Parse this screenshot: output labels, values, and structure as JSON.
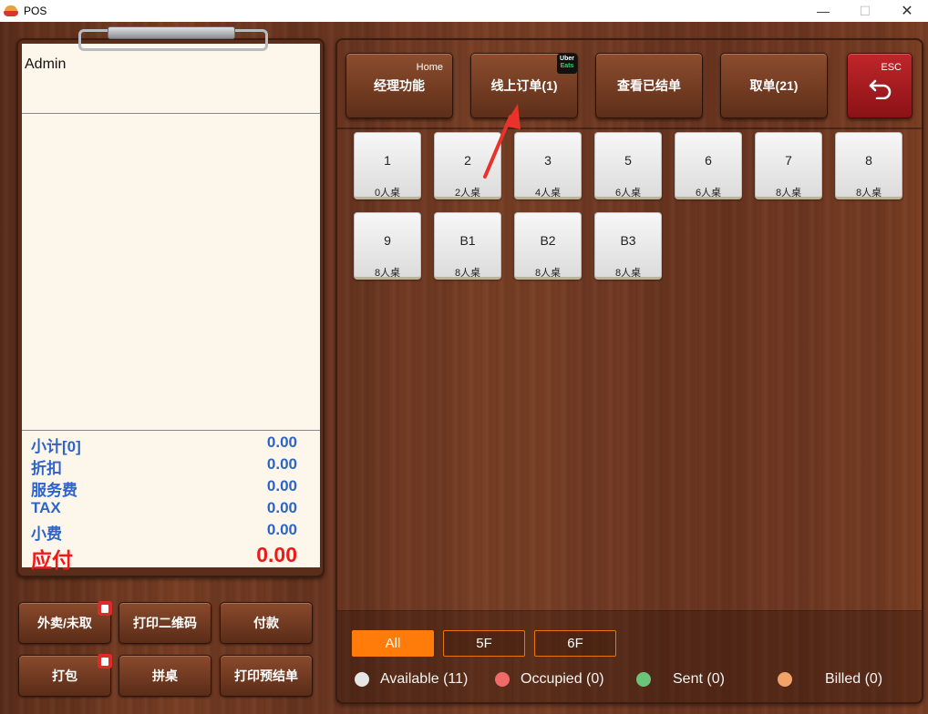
{
  "window": {
    "title": "POS",
    "minimize": "—",
    "maximize": "☐",
    "close": "✕"
  },
  "receipt": {
    "user": "Admin",
    "summary": [
      {
        "label": "小计[0]",
        "value": "0.00"
      },
      {
        "label": "折扣",
        "value": "0.00"
      },
      {
        "label": "服务费",
        "value": "0.00"
      },
      {
        "label": "TAX",
        "value": "0.00"
      },
      {
        "label": "小费",
        "value": "0.00"
      }
    ],
    "due": {
      "label": "应付",
      "value": "0.00"
    }
  },
  "left_buttons": {
    "takeout": "外卖/未取",
    "print_qr": "打印二维码",
    "pay": "付款",
    "pack": "打包",
    "merge": "拼桌",
    "print_prebill": "打印预结单"
  },
  "top_buttons": {
    "manager": {
      "label": "经理功能",
      "corner": "Home"
    },
    "online_orders": {
      "label": "线上订单(1)",
      "badge_top": "Uber",
      "badge_bottom": "Eats"
    },
    "view_settled": {
      "label": "查看已结单"
    },
    "pickup": {
      "label": "取单(21)"
    },
    "esc": {
      "corner": "ESC"
    }
  },
  "tables": [
    {
      "name": "1",
      "capacity": "0人桌"
    },
    {
      "name": "2",
      "capacity": "2人桌"
    },
    {
      "name": "3",
      "capacity": "4人桌"
    },
    {
      "name": "5",
      "capacity": "6人桌"
    },
    {
      "name": "6",
      "capacity": "6人桌"
    },
    {
      "name": "7",
      "capacity": "8人桌"
    },
    {
      "name": "8",
      "capacity": "8人桌"
    },
    {
      "name": "9",
      "capacity": "8人桌"
    },
    {
      "name": "B1",
      "capacity": "8人桌"
    },
    {
      "name": "B2",
      "capacity": "8人桌"
    },
    {
      "name": "B3",
      "capacity": "8人桌"
    }
  ],
  "floor_filters": [
    {
      "label": "All",
      "active": true
    },
    {
      "label": "5F",
      "active": false
    },
    {
      "label": "6F",
      "active": false
    }
  ],
  "legend": [
    {
      "label": "Available (11)",
      "color": "#e6e6e6"
    },
    {
      "label": "Occupied (0)",
      "color": "#f06a6a"
    },
    {
      "label": "Sent (0)",
      "color": "#6cc47a"
    },
    {
      "label": "Billed (0)",
      "color": "#f2a36a"
    }
  ],
  "colors": {
    "accent_orange": "#ff7c0a",
    "summary_blue": "#2e64c8",
    "due_red": "#ee1a1a",
    "esc_red": "#b0202a"
  }
}
